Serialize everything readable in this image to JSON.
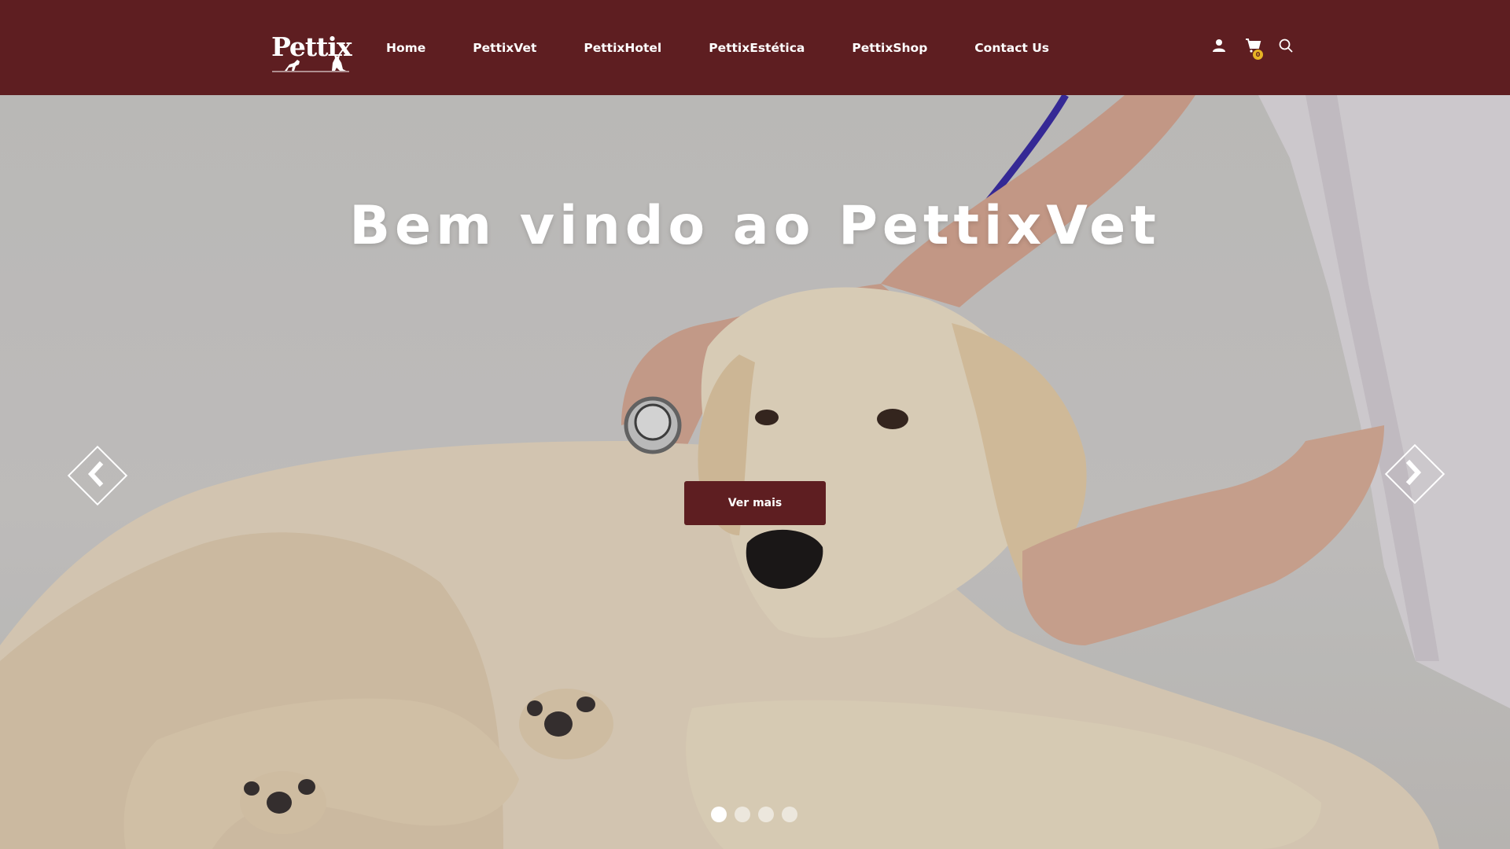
{
  "header": {
    "logo_text": "Pettix",
    "nav": [
      "Home",
      "PettixVet",
      "PettixHotel",
      "PettixEstética",
      "PettixShop",
      "Contact Us"
    ],
    "icons": [
      "user-icon",
      "cart-icon",
      "search-icon"
    ],
    "cart_count": "0"
  },
  "hero": {
    "title": "Bem vindo ao PettixVet",
    "button_label": "Ver mais",
    "slides_total": 4,
    "active_slide": 1
  },
  "colors": {
    "brand": "#5e1e21",
    "badge": "#e6b325",
    "text_light": "#ffffff"
  }
}
